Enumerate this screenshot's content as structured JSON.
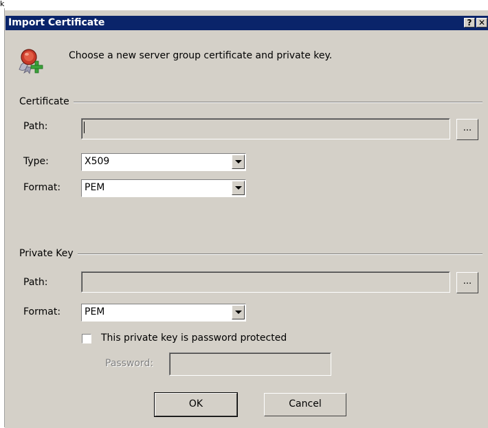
{
  "stray_text": "k",
  "window": {
    "title": "Import Certificate",
    "help_button": "?",
    "close_button": "✕"
  },
  "intro": "Choose a new server group certificate and private key.",
  "certificate": {
    "group_label": "Certificate",
    "path_label": "Path:",
    "path_value": "",
    "browse_label": "...",
    "type_label": "Type:",
    "type_value": "X509",
    "format_label": "Format:",
    "format_value": "PEM"
  },
  "private_key": {
    "group_label": "Private Key",
    "path_label": "Path:",
    "path_value": "",
    "browse_label": "...",
    "format_label": "Format:",
    "format_value": "PEM",
    "password_protected_label": "This private key is password protected",
    "password_protected_checked": false,
    "password_label": "Password:",
    "password_value": ""
  },
  "buttons": {
    "ok": "OK",
    "cancel": "Cancel"
  },
  "colors": {
    "titlebar": "#0a246a",
    "dialog_face": "#d4d0c8"
  },
  "icons": {
    "header_icon": "certificate-add-icon",
    "dropdown": "chevron-down-icon"
  }
}
